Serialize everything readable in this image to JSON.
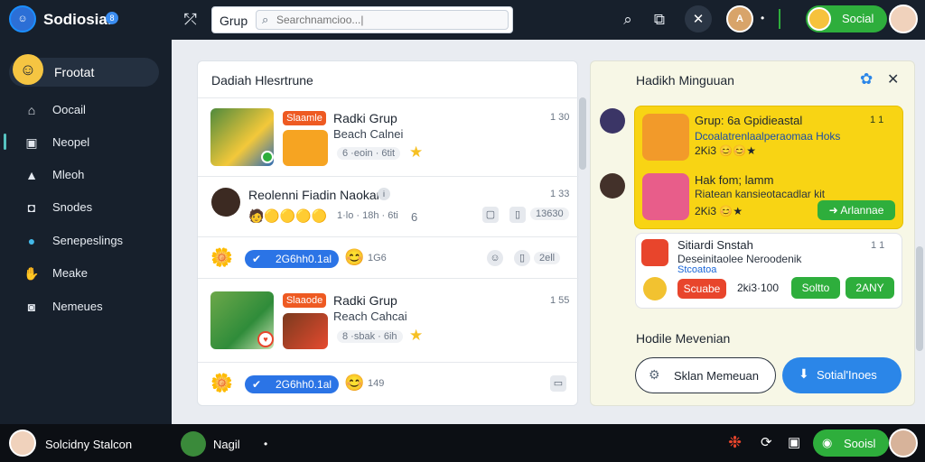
{
  "app": {
    "title": "Sodiosial",
    "badge": "8"
  },
  "search": {
    "label": "Grup",
    "placeholder": "Searchnamcioo...|"
  },
  "topbar": {
    "user_initial": "A",
    "dot_text": "•",
    "pill_label": "Social"
  },
  "sidebar": {
    "profile_label": "Frootat",
    "items": [
      {
        "label": "Oocail",
        "icon": "home-icon"
      },
      {
        "label": "Neopel",
        "icon": "image-icon"
      },
      {
        "label": "Mleoh",
        "icon": "triangle-icon"
      },
      {
        "label": "Snodes",
        "icon": "square-icon"
      },
      {
        "label": "Senepeslings",
        "icon": "globe-icon"
      },
      {
        "label": "Meake",
        "icon": "hands-icon"
      },
      {
        "label": "Nemeues",
        "icon": "camera-icon"
      }
    ]
  },
  "feed": {
    "title": "Dadiah Hlesrtrune",
    "posts": [
      {
        "tag": "Slaamle",
        "title": "Radki Grup",
        "subtitle": "Beach Calnei",
        "meta": "6 ·eoin · 6tit",
        "time": "1 30"
      },
      {
        "title": "Reolenni Fiadin Naokar",
        "badge": "i",
        "meta": "1·lo · 18h · 6ti",
        "extra": "6",
        "time": "1 33",
        "count": "13630"
      },
      {
        "pill": "2G6hh0.1al",
        "count": "1G6",
        "trailing": "2ell"
      },
      {
        "tag": "Slaaode",
        "title": "Radki Grup",
        "subtitle": "Reach Cahcai",
        "meta": "8 ·sbak · 6ih",
        "time": "1 55"
      },
      {
        "pill": "2G6hh0.1al",
        "count": "149"
      }
    ]
  },
  "right": {
    "title": "Hadikh Minguuan",
    "yellow_card": {
      "title": "Grup: 6a Gpidieastal",
      "time": "1 1",
      "text": "Dcoalatrenlaalperaomaa Hoks",
      "row1": "2Ki3",
      "item_title": "Hak fom; lamm",
      "item_text": "Riatean kansieotacadlar kit",
      "row2": "2Ki3",
      "action": "Arlannae"
    },
    "white_card": {
      "title": "Sitiardi Snstah",
      "time": "1 1",
      "text": "Deseinitaolee Neroodenik",
      "link": "Stcoatoa",
      "btn_red": "Scuabe",
      "amount": "2ki3·100",
      "btn_green1": "Soltto",
      "btn_green2": "2ANY"
    },
    "section_label": "Hodile Mevenian",
    "btn_outline": "Sklan Memeuan",
    "btn_blue": "Sotial'Inoes"
  },
  "bottombar": {
    "user_name": "Solcidny Stalcon",
    "friend_name": "Nagil",
    "dot": "•",
    "pill_label": "Sooisl"
  }
}
